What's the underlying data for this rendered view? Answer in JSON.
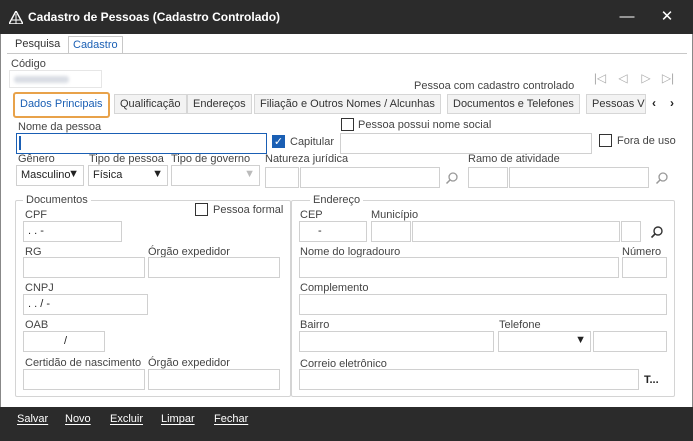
{
  "window": {
    "title": "Cadastro de Pessoas (Cadastro Controlado)",
    "minimize_glyph": "—",
    "close_glyph": "✕"
  },
  "top_tabs": [
    {
      "label": "Pesquisa",
      "active": false
    },
    {
      "label": "Cadastro",
      "active": true
    }
  ],
  "codigo": {
    "label": "Código",
    "value": ""
  },
  "controlled_text": "Pessoa com cadastro controlado",
  "nav_buttons": [
    "|◁",
    "◁",
    "▷",
    "▷|"
  ],
  "sub_tabs": [
    {
      "label": "Dados Principais",
      "active": true
    },
    {
      "label": "Qualificação",
      "active": false
    },
    {
      "label": "Endereços",
      "active": false
    },
    {
      "label": "Filiação e Outros Nomes / Alcunhas",
      "active": false
    },
    {
      "label": "Documentos e Telefones",
      "active": false
    },
    {
      "label": "Pessoas Vi",
      "active": false
    }
  ],
  "scroll_arrows": {
    "left": "‹",
    "right": "›"
  },
  "form": {
    "nome_label": "Nome da pessoa",
    "nome_value": "",
    "capitular_label": "Capitular",
    "capitular_checked": true,
    "nome_social_label": "Pessoa possui nome social",
    "nome_social_checked": false,
    "fora_de_uso_label": "Fora de uso",
    "fora_de_uso_checked": false,
    "genero_label": "Gênero",
    "genero_value": "Masculino",
    "tipo_pessoa_label": "Tipo de pessoa",
    "tipo_pessoa_value": "Física",
    "tipo_governo_label": "Tipo de governo",
    "tipo_governo_value": "",
    "natureza_label": "Natureza jurídica",
    "ramo_label": "Ramo de atividade"
  },
  "documentos": {
    "group_label": "Documentos",
    "pessoa_formal_label": "Pessoa formal",
    "pessoa_formal_checked": false,
    "cpf_label": "CPF",
    "cpf_mask": " .  .  -",
    "rg_label": "RG",
    "orgao_label": "Órgão expedidor",
    "cnpj_label": "CNPJ",
    "cnpj_mask": " .  .  /   -",
    "oab_label": "OAB",
    "oab_mask": "/",
    "certidao_label": "Certidão de nascimento",
    "orgao2_label": "Órgão expedidor"
  },
  "endereco": {
    "group_label": "Endereço",
    "cep_label": "CEP",
    "cep_mask": "  -",
    "municipio_label": "Município",
    "logradouro_label": "Nome do logradouro",
    "numero_label": "Número",
    "complemento_label": "Complemento",
    "bairro_label": "Bairro",
    "telefone_label": "Telefone",
    "correio_label": "Correio eletrônico",
    "correio_button": "T..."
  },
  "bottom_buttons": [
    "Salvar",
    "Novo",
    "Excluir",
    "Limpar",
    "Fechar"
  ],
  "colors": {
    "titlebar": "#2b2b2b",
    "accent": "#1a5fb4",
    "active_tab_border": "#e8a24a"
  }
}
